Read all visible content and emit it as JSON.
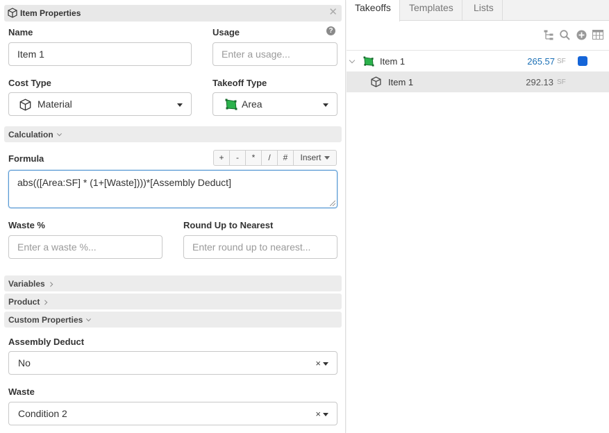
{
  "panel": {
    "title": "Item Properties",
    "close_glyph": "✕",
    "name": {
      "label": "Name",
      "value": "Item 1"
    },
    "usage": {
      "label": "Usage",
      "placeholder": "Enter a usage...",
      "help_glyph": "?"
    },
    "cost_type": {
      "label": "Cost Type",
      "value": "Material",
      "icon": "cube-icon"
    },
    "takeoff_type": {
      "label": "Takeoff Type",
      "value": "Area",
      "icon": "area-polygon-icon"
    },
    "calculation_section": "Calculation",
    "formula": {
      "label": "Formula",
      "operators": [
        "+",
        "-",
        "*",
        "/",
        "#"
      ],
      "insert_label": "Insert",
      "value": "abs(([Area:SF] * (1+[Waste])))*[Assembly Deduct]"
    },
    "waste_pct": {
      "label": "Waste %",
      "placeholder": "Enter a waste %..."
    },
    "round_up": {
      "label": "Round Up to Nearest",
      "placeholder": "Enter round up to nearest..."
    },
    "variables_section": "Variables",
    "product_section": "Product",
    "custom_properties_section": "Custom Properties",
    "assembly_deduct": {
      "label": "Assembly Deduct",
      "value": "No",
      "clear_glyph": "×"
    },
    "waste": {
      "label": "Waste",
      "value": "Condition 2",
      "clear_glyph": "×"
    }
  },
  "right": {
    "tabs": [
      "Takeoffs",
      "Templates",
      "Lists"
    ],
    "active_tab": "Takeoffs",
    "toolbar_icons": [
      "tree-icon",
      "search-icon",
      "add-circle-icon",
      "table-icon"
    ],
    "rows": [
      {
        "name": "Item 1",
        "value": "265.57",
        "unit": "SF",
        "icon": "area-polygon-icon",
        "color": "#1565d8"
      },
      {
        "name": "Item 1",
        "value": "292.13",
        "unit": "SF",
        "icon": "cube-icon"
      }
    ]
  },
  "colors": {
    "accent_blue": "#1a6fb5",
    "area_green": "#2bb24c",
    "focus_border": "#5b9bd5"
  }
}
